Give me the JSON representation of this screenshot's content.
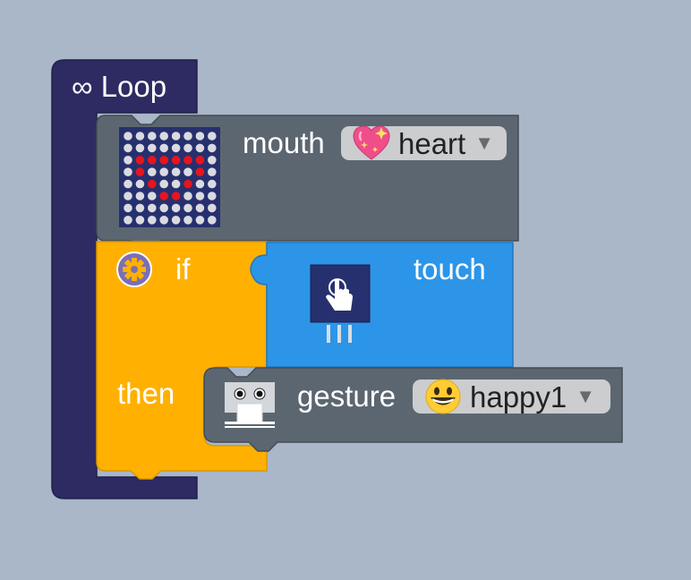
{
  "workspace": {
    "background": "#a9b7c8"
  },
  "loop_block": {
    "label": "∞ Loop",
    "color": "#2e2b63"
  },
  "mouth_block": {
    "label": "mouth",
    "selected_value": "heart",
    "value_icon": "sparkling-heart-icon",
    "image_icon": "led-matrix-heart-icon",
    "color": "#5c6670"
  },
  "if_block": {
    "if_label": "if",
    "then_label": "then",
    "gear_icon": "gear-icon",
    "color": "#ffb000"
  },
  "touch_block": {
    "label": "touch",
    "icon": "touch-sensor-icon",
    "color": "#2c95e8"
  },
  "gesture_block": {
    "label": "gesture",
    "selected_value": "happy1",
    "value_icon": "grinning-face-icon",
    "image_icon": "robot-face-icon",
    "color": "#5c6670"
  }
}
